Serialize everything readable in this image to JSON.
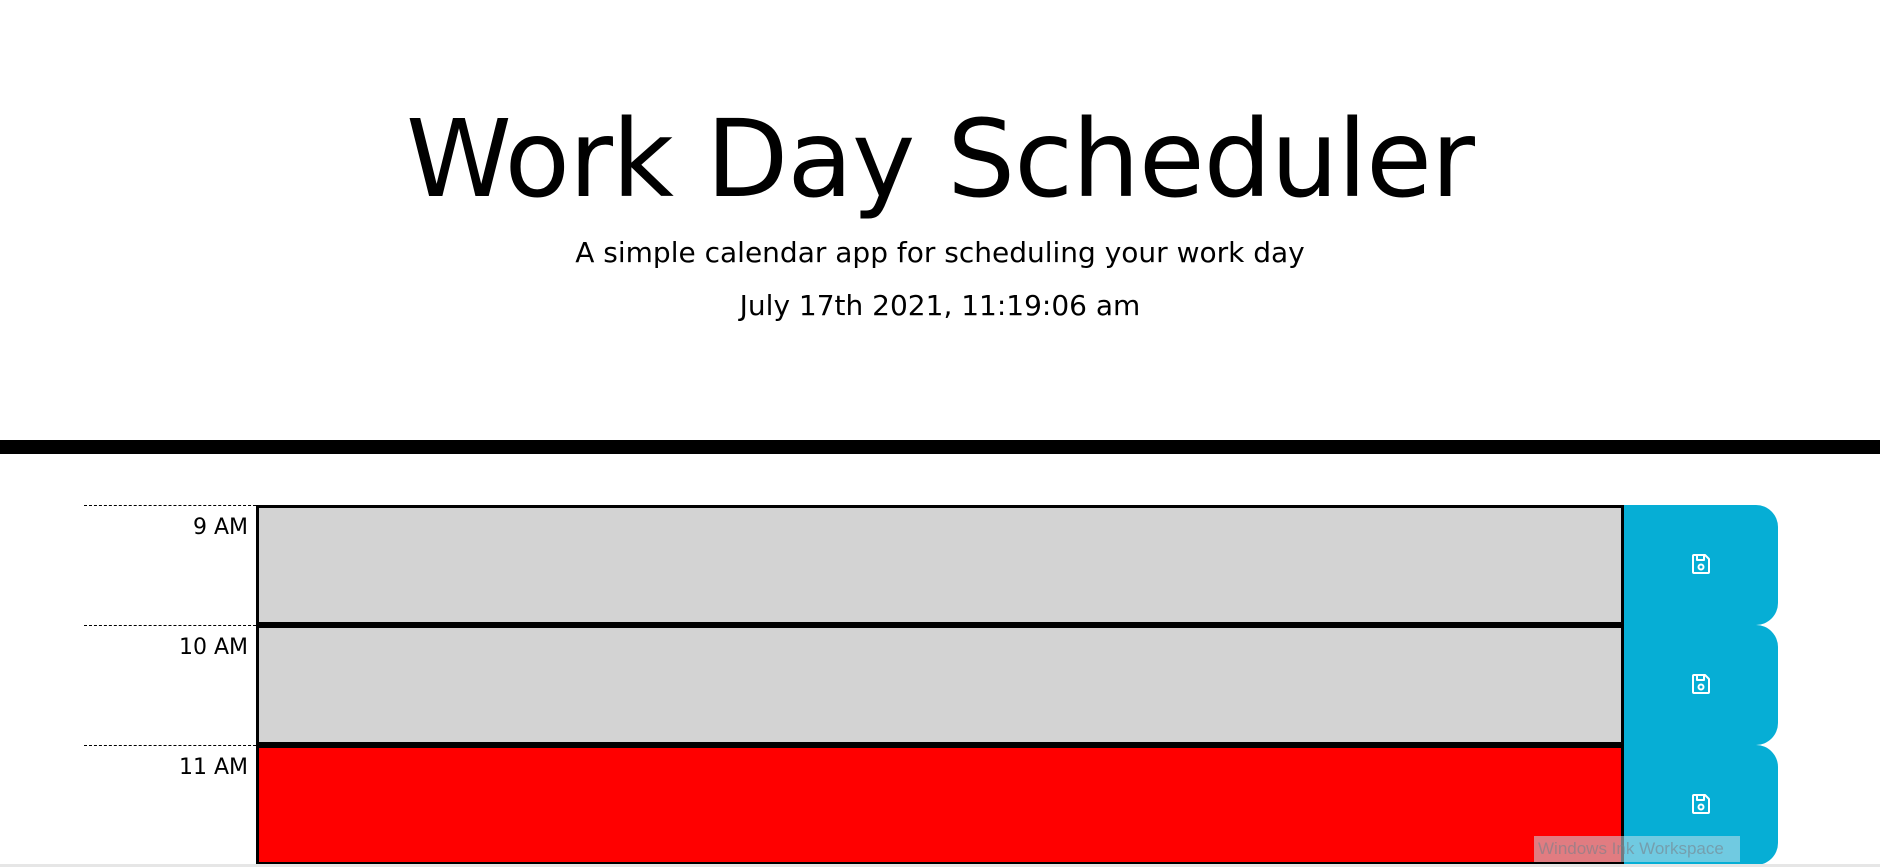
{
  "header": {
    "title": "Work Day Scheduler",
    "subtitle": "A simple calendar app for scheduling your work day",
    "current_datetime": "July 17th 2021, 11:19:06 am"
  },
  "time_blocks": [
    {
      "hour_label": "9 AM",
      "status": "past",
      "description": "",
      "save_icon": "floppy-disk-icon"
    },
    {
      "hour_label": "10 AM",
      "status": "past",
      "description": "",
      "save_icon": "floppy-disk-icon"
    },
    {
      "hour_label": "11 AM",
      "status": "present",
      "description": "",
      "save_icon": "floppy-disk-icon"
    }
  ],
  "colors": {
    "past": "#d3d3d3",
    "present": "#ff0000",
    "save_button": "#06aed5",
    "divider": "#000000"
  },
  "overlay": {
    "watermark_text": "Windows Ink Workspace"
  }
}
